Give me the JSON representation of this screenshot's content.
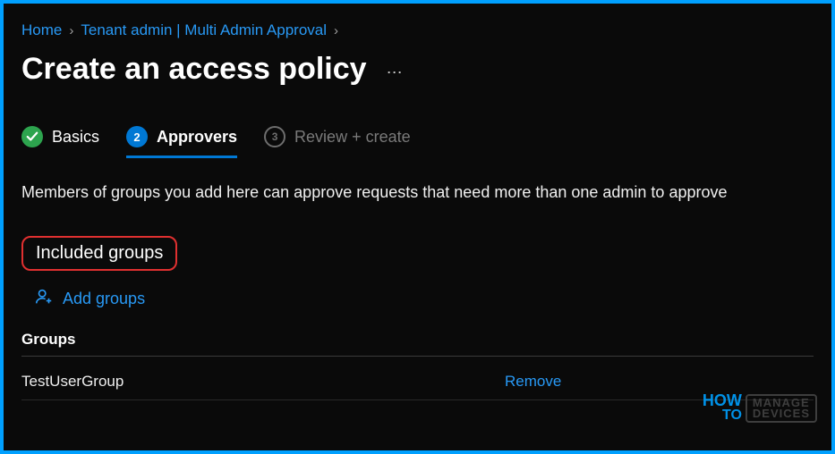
{
  "breadcrumb": {
    "home": "Home",
    "tenant": "Tenant admin | Multi Admin Approval"
  },
  "title": "Create an access policy",
  "tabs": {
    "basics": "Basics",
    "approvers_num": "2",
    "approvers": "Approvers",
    "review_num": "3",
    "review": "Review + create"
  },
  "description": "Members of groups you add here can approve requests that need more than one admin to approve",
  "section_heading": "Included groups",
  "add_groups_label": "Add groups",
  "groups_header": "Groups",
  "group_rows": [
    {
      "name": "TestUserGroup",
      "action": "Remove"
    }
  ],
  "watermark": {
    "how": "HOW",
    "to": "TO",
    "line1": "MANAGE",
    "line2": "DEVICES"
  }
}
